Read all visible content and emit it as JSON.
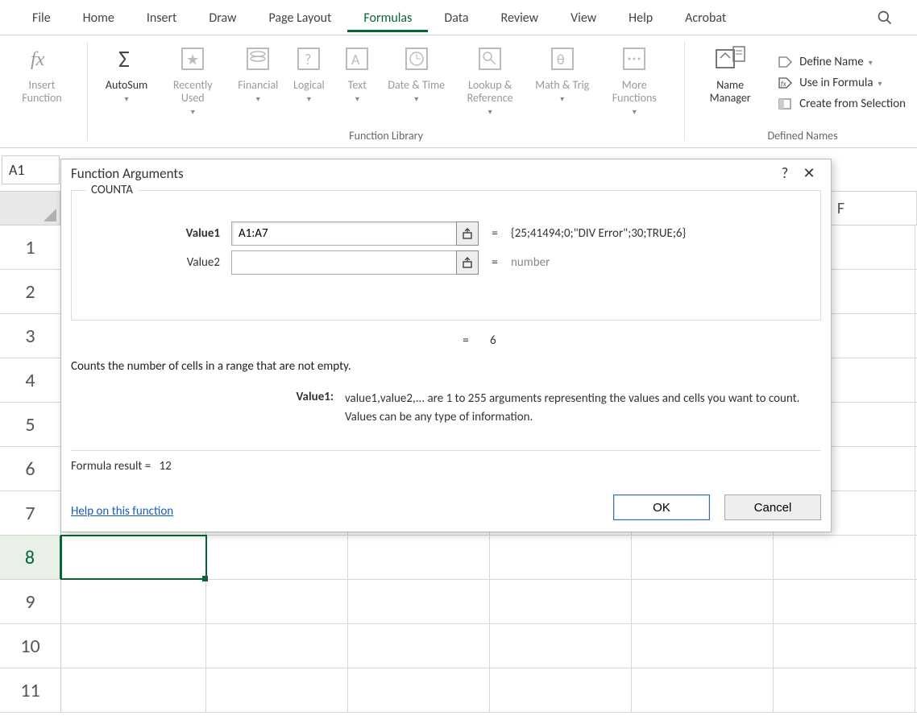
{
  "tabs": {
    "file": "File",
    "home": "Home",
    "insert": "Insert",
    "draw": "Draw",
    "page_layout": "Page Layout",
    "formulas": "Formulas",
    "data": "Data",
    "review": "Review",
    "view": "View",
    "help": "Help",
    "acrobat": "Acrobat"
  },
  "ribbon": {
    "function_library_label": "Function Library",
    "defined_names_label": "Defined Names",
    "insert_function": "Insert Function",
    "autosum": "AutoSum",
    "recently_used": "Recently Used",
    "financial": "Financial",
    "logical": "Logical",
    "text": "Text",
    "date_time": "Date & Time",
    "lookup_reference": "Lookup & Reference",
    "math_trig": "Math & Trig",
    "more_functions": "More Functions",
    "name_manager": "Name Manager",
    "define_name": "Define Name",
    "use_in_formula": "Use in Formula",
    "create_from_selection": "Create from Selection"
  },
  "name_box": "A1",
  "columns": [
    "F"
  ],
  "rows": [
    "1",
    "2",
    "3",
    "4",
    "5",
    "6",
    "7",
    "8",
    "9",
    "10",
    "11"
  ],
  "selected_row": "8",
  "dialog": {
    "title": "Function Arguments",
    "function": "COUNTA",
    "args": {
      "value1_label": "Value1",
      "value1": "A1:A7",
      "value1_preview": "{25;41494;0;\"DIV Error\";30;TRUE;6}",
      "value2_label": "Value2",
      "value2": "",
      "value2_preview": "number"
    },
    "equals": "=",
    "preview_result": "6",
    "description": "Counts the number of cells in a range that are not empty.",
    "arg_desc_label": "Value1:",
    "arg_desc_text": "value1,value2,... are 1 to 255 arguments representing the values and cells you want to count. Values can be any type of information.",
    "formula_result_label": "Formula result =",
    "formula_result": "12",
    "help_link": "Help on this function",
    "ok": "OK",
    "cancel": "Cancel",
    "help_symbol": "?",
    "close_symbol": "✕"
  }
}
